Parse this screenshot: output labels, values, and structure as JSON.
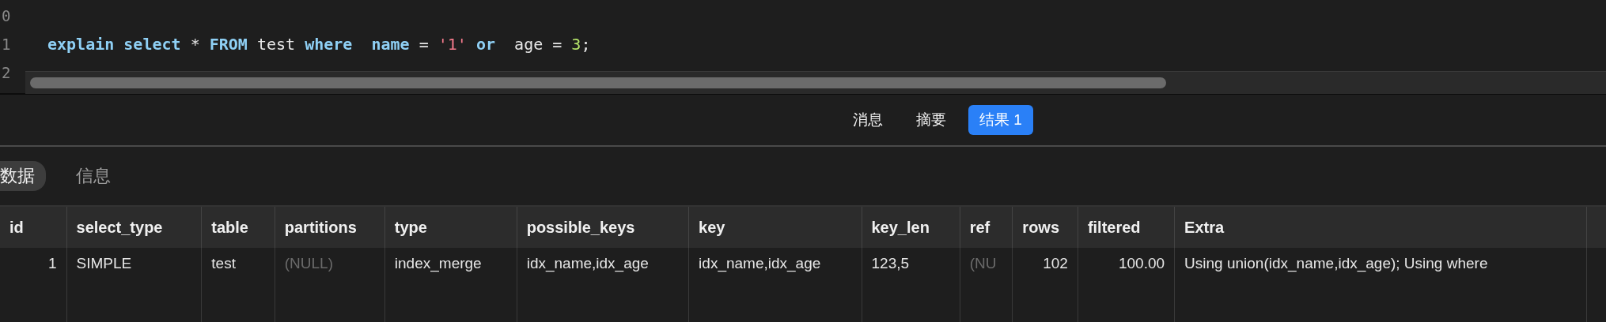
{
  "editor": {
    "lines": [
      {
        "number": "0"
      },
      {
        "number": "1",
        "tokens": [
          {
            "kind": "keyword",
            "text": "explain "
          },
          {
            "kind": "keyword",
            "text": "select "
          },
          {
            "kind": "plain",
            "text": "* "
          },
          {
            "kind": "keyword",
            "text": "FROM "
          },
          {
            "kind": "plain",
            "text": "test "
          },
          {
            "kind": "keyword",
            "text": "where  "
          },
          {
            "kind": "keyword",
            "text": "name "
          },
          {
            "kind": "plain",
            "text": "= "
          },
          {
            "kind": "string",
            "text": "'1'"
          },
          {
            "kind": "keyword",
            "text": " or  "
          },
          {
            "kind": "plain",
            "text": "age = "
          },
          {
            "kind": "number",
            "text": "3"
          },
          {
            "kind": "plain",
            "text": ";"
          }
        ]
      },
      {
        "number": "2"
      }
    ]
  },
  "result_tabs": [
    {
      "label": "消息",
      "selected": false
    },
    {
      "label": "摘要",
      "selected": false
    },
    {
      "label": "结果 1",
      "selected": true
    }
  ],
  "view_tabs": [
    {
      "label": "数据",
      "selected": true
    },
    {
      "label": "信息",
      "selected": false
    }
  ],
  "table": {
    "columns": [
      "id",
      "select_type",
      "table",
      "partitions",
      "type",
      "possible_keys",
      "key",
      "key_len",
      "ref",
      "rows",
      "filtered",
      "Extra"
    ],
    "rows": [
      [
        {
          "kind": "number",
          "text": "1"
        },
        {
          "kind": "text",
          "text": "SIMPLE"
        },
        {
          "kind": "text",
          "text": "test"
        },
        {
          "kind": "null",
          "text": "(NULL)"
        },
        {
          "kind": "text",
          "text": "index_merge"
        },
        {
          "kind": "text",
          "text": "idx_name,idx_age"
        },
        {
          "kind": "text",
          "text": "idx_name,idx_age"
        },
        {
          "kind": "text",
          "text": "123,5"
        },
        {
          "kind": "null",
          "text": "(NU"
        },
        {
          "kind": "number",
          "text": "102"
        },
        {
          "kind": "number",
          "text": "100.00"
        },
        {
          "kind": "text",
          "text": "Using union(idx_name,idx_age); Using where"
        }
      ]
    ]
  }
}
